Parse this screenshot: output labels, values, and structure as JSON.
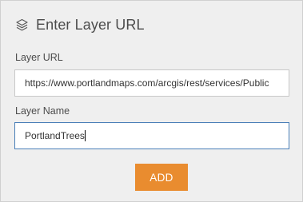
{
  "dialog": {
    "title": "Enter Layer URL",
    "header_icon": "layers-icon"
  },
  "layer_url": {
    "label": "Layer URL",
    "value": "https://www.portlandmaps.com/arcgis/rest/services/Public"
  },
  "layer_name": {
    "label": "Layer Name",
    "value": "PortlandTrees"
  },
  "add_button": {
    "label": "ADD"
  },
  "colors": {
    "accent": "#e98c2f",
    "focus_border": "#4a7fb8",
    "panel_background": "#efefef"
  }
}
